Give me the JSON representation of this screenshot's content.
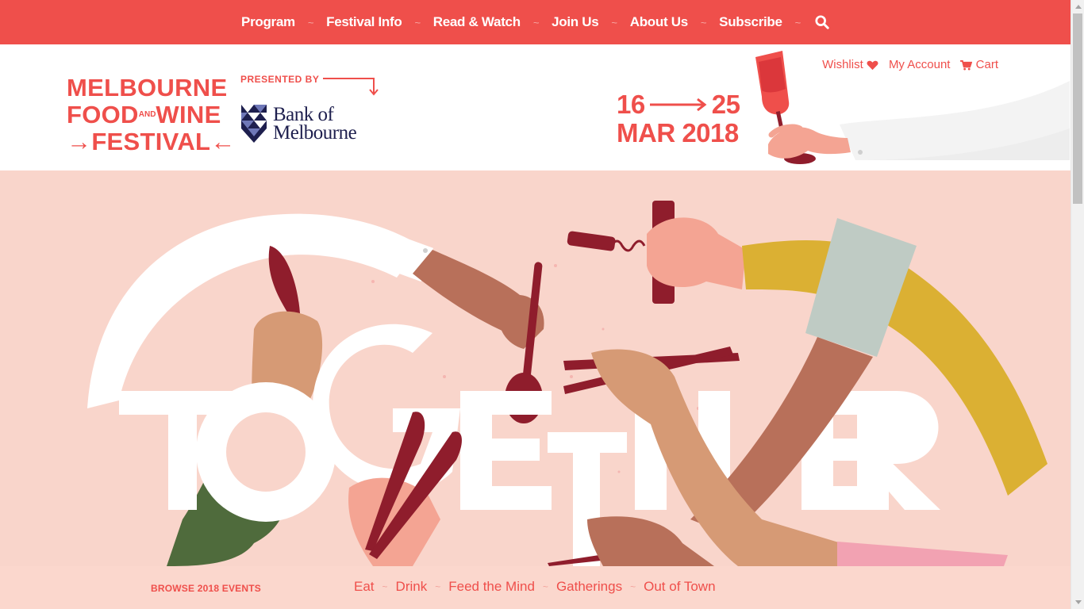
{
  "nav": {
    "items": [
      {
        "label": "Program"
      },
      {
        "label": "Festival Info"
      },
      {
        "label": "Read & Watch"
      },
      {
        "label": "Join Us"
      },
      {
        "label": "About Us"
      },
      {
        "label": "Subscribe"
      }
    ],
    "separator": "~",
    "search_icon": "search-icon"
  },
  "header": {
    "logo": {
      "line1": "MELBOURNE",
      "line2a": "FOOD",
      "line2_small": "AND",
      "line2b": "WINE",
      "line3": "FESTIVAL"
    },
    "presented_by": "PRESENTED BY",
    "sponsor": {
      "line1": "Bank of",
      "line2": "Melbourne"
    },
    "dates": {
      "start_day": "16",
      "end_day": "25",
      "month_year": "MAR 2018"
    },
    "account": {
      "wishlist": "Wishlist",
      "my_account": "My Account",
      "cart": "Cart"
    }
  },
  "hero": {
    "word": "TOGETHER"
  },
  "browse": {
    "label": "BROWSE 2018 EVENTS",
    "categories": [
      "Eat",
      "Drink",
      "Feed the Mind",
      "Gatherings",
      "Out of Town"
    ],
    "separator": "~"
  },
  "colors": {
    "brand_red": "#ef4f4b",
    "hero_bg": "#f9d5cb",
    "navy": "#1e1f4e",
    "wine": "#8f1d2c",
    "mustard": "#dbb033",
    "sage": "#bfcbc4",
    "olive": "#4f6b3c"
  }
}
